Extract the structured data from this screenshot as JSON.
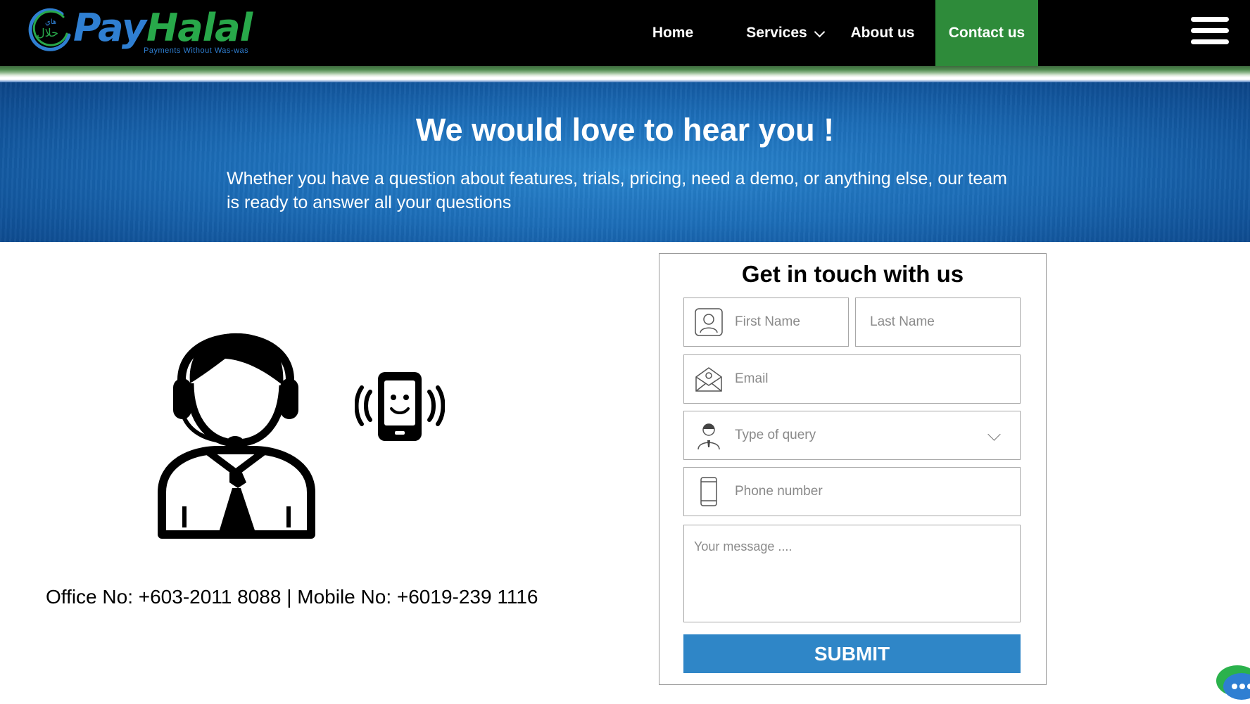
{
  "header": {
    "logo": {
      "brand_first": "Pay",
      "brand_second": "Halal",
      "tagline": "Payments Without Was-was",
      "arabic_mark": "حلال"
    },
    "nav": [
      {
        "label": "Home"
      },
      {
        "label": "Services"
      },
      {
        "label": "About us"
      },
      {
        "label": "Contact us"
      }
    ],
    "colors": {
      "background": "#000000",
      "active_nav": "#2e8b3a",
      "brand_blue": "#2f7fd2",
      "brand_green": "#28a84a"
    }
  },
  "hero": {
    "title": "We would love to hear you !",
    "subtitle": "Whether you have a question about features, trials, pricing, need a demo, or anything else, our team is ready to answer all your questions"
  },
  "contact_info": {
    "text": "Office No: +603-2011 8088 | Mobile No: +6019-239 1116"
  },
  "form": {
    "title": "Get in touch with us",
    "first_name_placeholder": "First Name",
    "last_name_placeholder": "Last Name",
    "email_placeholder": "Email",
    "query_placeholder": "Type of query",
    "phone_placeholder": "Phone number",
    "message_placeholder": "Your message ....",
    "submit_label": "SUBMIT",
    "submit_color": "#2f86c7"
  },
  "icons": [
    "menu-icon",
    "chevron-down-icon",
    "user-icon",
    "email-icon",
    "agent-icon",
    "phone-icon",
    "chat-icon"
  ]
}
